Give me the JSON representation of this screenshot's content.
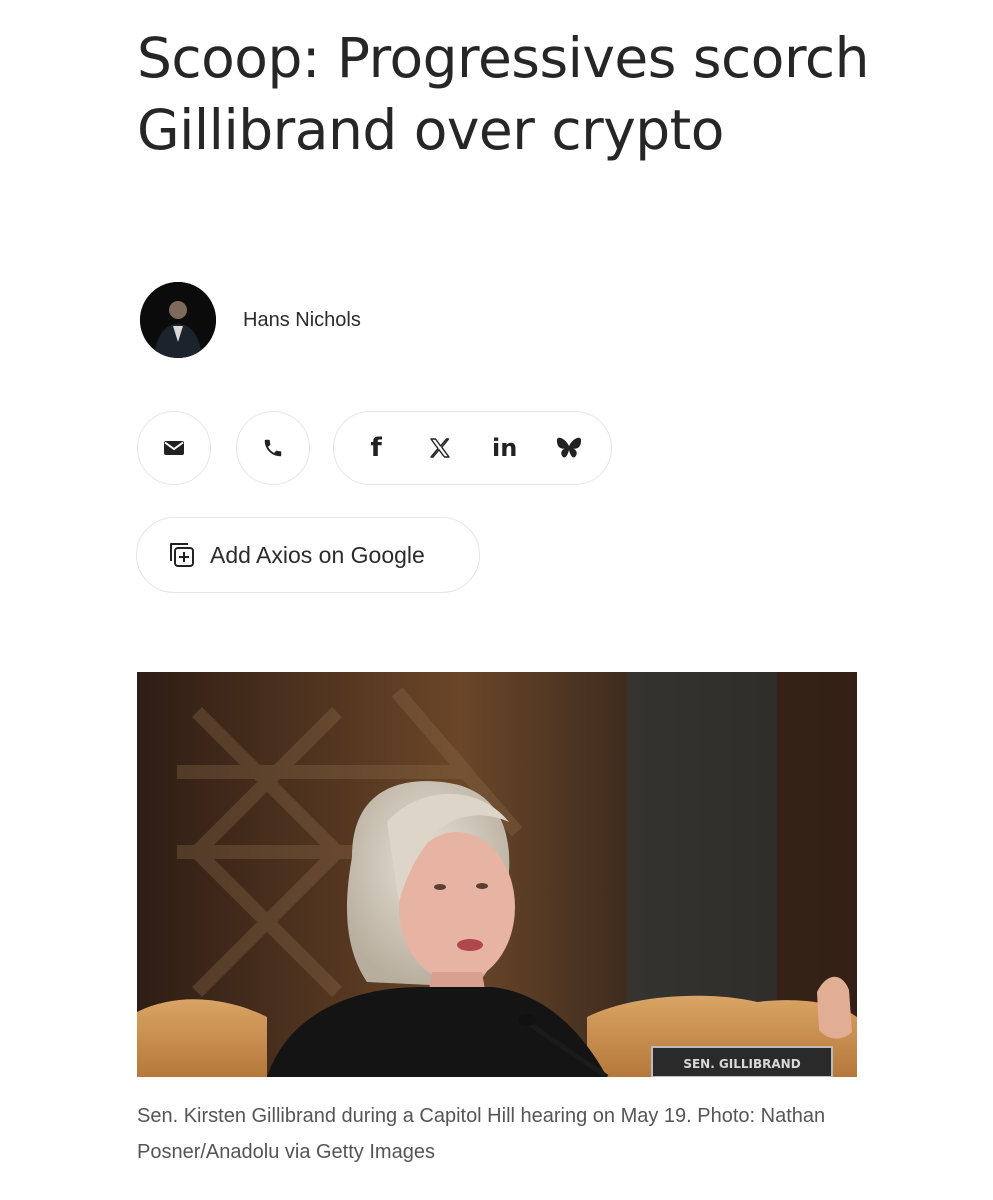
{
  "article": {
    "headline": "Scoop: Progressives scorch Gillibrand over crypto",
    "author": {
      "name": "Hans Nichols",
      "avatar_icon": "author-portrait"
    },
    "caption": "Sen. Kirsten Gillibrand during a Capitol Hill hearing on May 19. Photo: Nathan Posner/Anadolu via Getty Images",
    "photo": {
      "nameplate": "SEN. GILLIBRAND"
    }
  },
  "share": {
    "email_icon": "envelope-icon",
    "phone_icon": "phone-icon",
    "facebook_glyph": "f",
    "x_glyph": "𝕏",
    "linkedin_glyph": "in",
    "bluesky_icon": "butterfly-icon"
  },
  "add_google": {
    "label": "Add Axios on Google",
    "icon": "add-to-stack-icon"
  },
  "colors": {
    "text": "#262626",
    "caption": "#555555",
    "border": "#e6e6e6"
  }
}
